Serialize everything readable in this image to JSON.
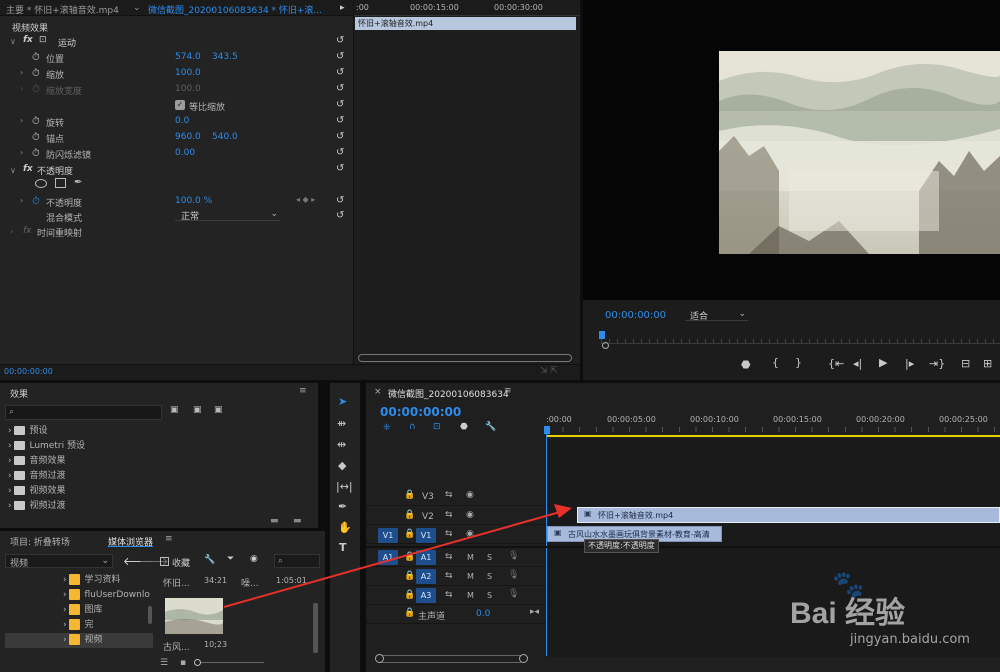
{
  "source_monitor": {
    "tab1": "主要 * 怀旧+滚轴音效.mp4",
    "tab2": "微信截图_20200106083634 * 怀旧+滚...",
    "section": "视频效果",
    "fx_motion": "运动",
    "props": [
      {
        "name": "位置",
        "v1": "574.0",
        "v2": "343.5"
      },
      {
        "name": "缩放",
        "v1": "100.0"
      },
      {
        "name": "缩放宽度",
        "v1": "100.0"
      },
      {
        "name": "等比缩放"
      },
      {
        "name": "旋转",
        "v1": "0.0"
      },
      {
        "name": "锚点",
        "v1": "960.0",
        "v2": "540.0"
      },
      {
        "name": "防闪烁滤镜",
        "v1": "0.00"
      }
    ],
    "fx_opacity": "不透明度",
    "opacity_label": "不透明度",
    "opacity_value": "100.0 %",
    "blend_label": "混合模式",
    "blend_value": "正常",
    "time_remap": "时间重映射",
    "timecode": "00:00:00:00",
    "mini_ruler": [
      ":00",
      "00:00:15:00",
      "00:00:30:00"
    ],
    "mini_clip": "怀旧+滚轴音效.mp4"
  },
  "program": {
    "timecode": "00:00:00:00",
    "fit": "适合"
  },
  "effects": {
    "title": "效果",
    "items": [
      "预设",
      "Lumetri 预设",
      "音频效果",
      "音频过渡",
      "视频效果",
      "视频过渡"
    ]
  },
  "browser": {
    "tab_project": "项目: 折叠转场",
    "tab_media": "媒体浏览器",
    "type_select": "视频",
    "favorite": "收藏",
    "folders": [
      "学习资料",
      "fluUserDownlo",
      "图库",
      "完",
      "视频"
    ],
    "col1": "怀旧...",
    "col1_dur": "34:21",
    "col2": "噪...",
    "col2_dur": "1:05:01",
    "thumb_name": "古风...",
    "thumb_dur": "10;23"
  },
  "timeline": {
    "title": "微信截图_20200106083634",
    "timecode": "00:00:00:00",
    "ruler": [
      ":00:00",
      "00:00:05:00",
      "00:00:10:00",
      "00:00:15:00",
      "00:00:20:00",
      "00:00:25:00"
    ],
    "video_tracks": [
      "V3",
      "V2",
      "V1"
    ],
    "audio_tracks": [
      "A1",
      "A2",
      "A3"
    ],
    "master": "主声道",
    "master_value": "0.0",
    "src_v1": "V1",
    "src_a1": "A1",
    "clip_v2": "怀旧+滚轴音效.mp4",
    "clip_v1": "古风山水水墨画玩俱背景素材-教育-高清",
    "tooltip": "不透明度:不透明度",
    "m": "M",
    "s": "S"
  },
  "watermark": {
    "brand": "Bai 经验",
    "url": "jingyan.baidu.com"
  }
}
